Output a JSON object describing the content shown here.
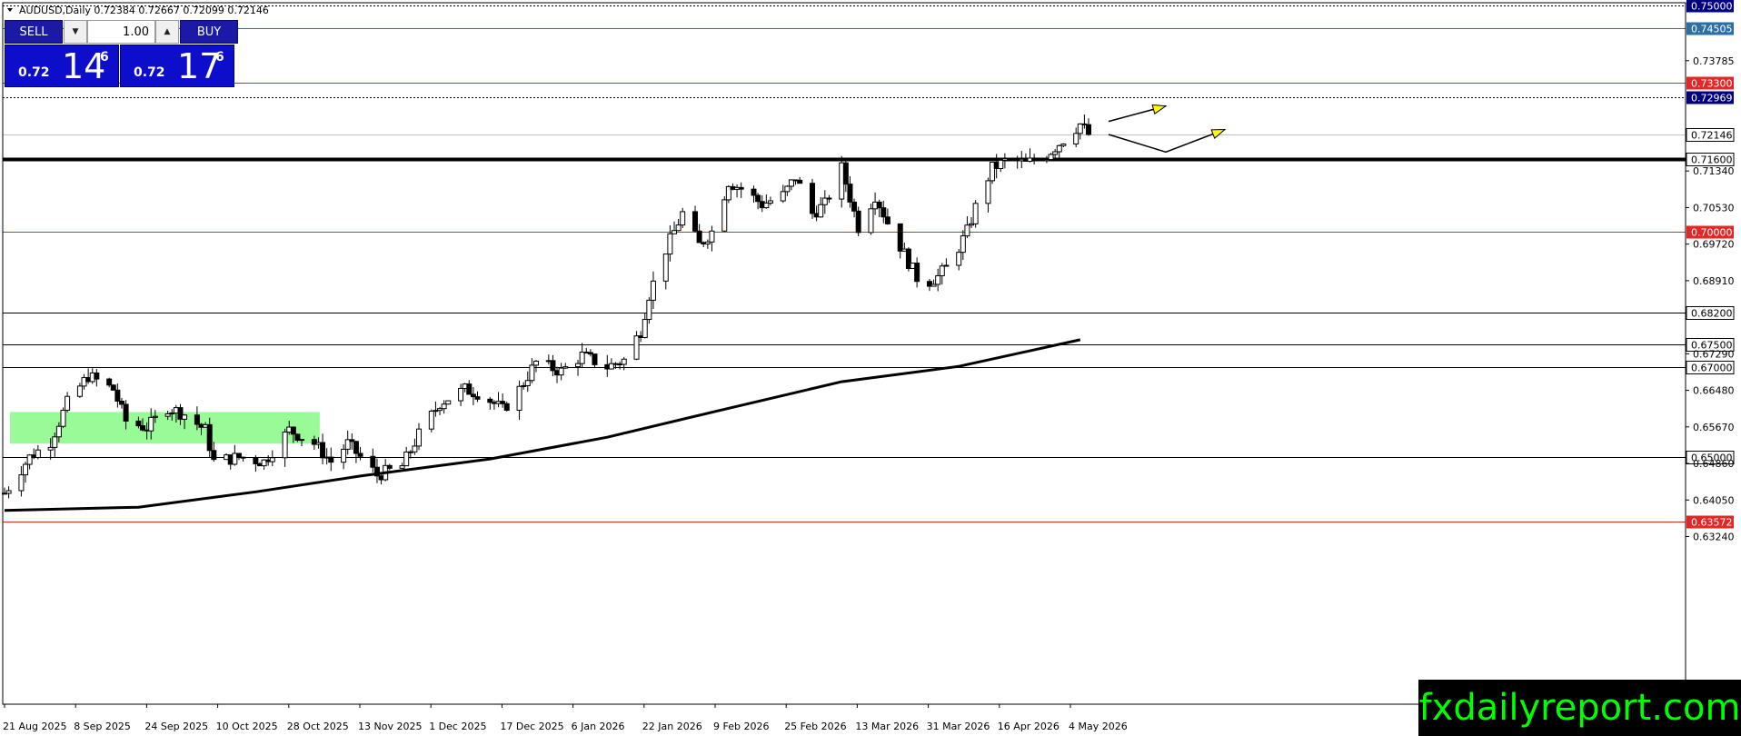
{
  "header": {
    "title": "AUDUSD,Daily  0.72384 0.72667 0.72099 0.72146"
  },
  "trade_panel": {
    "sell_label": "SELL",
    "buy_label": "BUY",
    "lot_size": "1.00",
    "sell_price": {
      "prefix": "0.72",
      "big": "14",
      "sup": "6"
    },
    "buy_price": {
      "prefix": "0.72",
      "big": "17",
      "sup": "6"
    }
  },
  "watermark": "fxdailyreport.com",
  "colors": {
    "green_zone": "#98fb98",
    "red_level": "#e32626",
    "blue_level": "#2e6ea6",
    "arrow_fill": "#ffff00",
    "watermark_text": "#00ff00"
  },
  "chart_data": {
    "type": "candlestick",
    "symbol": "AUDUSD",
    "timeframe": "Daily",
    "ohlc_current": {
      "open": 0.72384,
      "high": 0.72667,
      "low": 0.72099,
      "close": 0.72146
    },
    "ylim": [
      0.6275,
      0.752
    ],
    "y_ticks": [
      "0.73785",
      "0.71340",
      "0.70530",
      "0.69720",
      "0.68910",
      "0.67290",
      "0.66480",
      "0.65670",
      "0.64860",
      "0.64050",
      "0.63240"
    ],
    "x_labels": [
      "21 Aug 2025",
      "8 Sep 2025",
      "24 Sep 2025",
      "10 Oct 2025",
      "28 Oct 2025",
      "13 Nov 2025",
      "1 Dec 2025",
      "17 Dec 2025",
      "6 Jan 2026",
      "22 Jan 2026",
      "9 Feb 2026",
      "25 Feb 2026",
      "13 Mar 2026",
      "31 Mar 2026",
      "16 Apr 2026",
      "4 May 2026"
    ],
    "levels": [
      {
        "price": "0.75000",
        "value": 0.75,
        "style": "dotted",
        "color": "#000000",
        "label_bg": "#000080"
      },
      {
        "price": "0.74505",
        "value": 0.74505,
        "style": "solid",
        "color": "#2e6ea6",
        "label_bg": "#2e6ea6"
      },
      {
        "price": "0.73300",
        "value": 0.733,
        "style": "solid",
        "color": "#e32626",
        "label_bg": "#e32626"
      },
      {
        "price": "0.72969",
        "value": 0.72969,
        "style": "dotted",
        "color": "#000000",
        "label_bg": "#000080"
      },
      {
        "price": "0.72146",
        "value": 0.72146,
        "style": "solid",
        "color": "#c0c0c0",
        "label_bg": "#ffffff"
      },
      {
        "price": "0.71600",
        "value": 0.716,
        "style": "thick",
        "color": "#000000",
        "label_bg": "#ffffff"
      },
      {
        "price": "0.70000",
        "value": 0.7,
        "style": "solid",
        "color": "#e32626",
        "label_bg": "#e32626"
      },
      {
        "price": "0.68200",
        "value": 0.682,
        "style": "solid",
        "color": "#000000",
        "label_bg": "#ffffff"
      },
      {
        "price": "0.67500",
        "value": 0.675,
        "style": "solid",
        "color": "#000000",
        "label_bg": "#ffffff"
      },
      {
        "price": "0.67000",
        "value": 0.67,
        "style": "solid",
        "color": "#000000",
        "label_bg": "#ffffff"
      },
      {
        "price": "0.65000",
        "value": 0.65,
        "style": "solid",
        "color": "#000000",
        "label_bg": "#ffffff"
      },
      {
        "price": "0.63572",
        "value": 0.63572,
        "style": "solid",
        "color": "#e32626",
        "label_bg": "#e32626"
      }
    ],
    "moving_average": [
      {
        "date": "2025-08-21",
        "value": 0.6382
      },
      {
        "date": "2025-09-22",
        "value": 0.6389
      },
      {
        "date": "2025-10-20",
        "value": 0.6423
      },
      {
        "date": "2025-11-14",
        "value": 0.6458
      },
      {
        "date": "2025-12-15",
        "value": 0.6496
      },
      {
        "date": "2026-01-12",
        "value": 0.6544
      },
      {
        "date": "2026-02-09",
        "value": 0.6606
      },
      {
        "date": "2026-03-09",
        "value": 0.6667
      },
      {
        "date": "2026-04-06",
        "value": 0.6701
      },
      {
        "date": "2026-05-05",
        "value": 0.676
      }
    ],
    "zones": [
      {
        "from": "2025-08-21",
        "to": "2025-11-03",
        "low": 0.653,
        "high": 0.66,
        "color": "#98fb98"
      }
    ],
    "price_path": [
      {
        "date": "2025-08-21",
        "value": 0.642
      },
      {
        "date": "2025-08-27",
        "value": 0.65
      },
      {
        "date": "2025-09-01",
        "value": 0.6535
      },
      {
        "date": "2025-09-05",
        "value": 0.662
      },
      {
        "date": "2025-09-10",
        "value": 0.668
      },
      {
        "date": "2025-09-16",
        "value": 0.665
      },
      {
        "date": "2025-09-19",
        "value": 0.658
      },
      {
        "date": "2025-09-24",
        "value": 0.6565
      },
      {
        "date": "2025-09-29",
        "value": 0.661
      },
      {
        "date": "2025-10-03",
        "value": 0.6595
      },
      {
        "date": "2025-10-08",
        "value": 0.656
      },
      {
        "date": "2025-10-10",
        "value": 0.649
      },
      {
        "date": "2025-10-16",
        "value": 0.65
      },
      {
        "date": "2025-10-22",
        "value": 0.649
      },
      {
        "date": "2025-10-28",
        "value": 0.656
      },
      {
        "date": "2025-11-03",
        "value": 0.653
      },
      {
        "date": "2025-11-07",
        "value": 0.649
      },
      {
        "date": "2025-11-11",
        "value": 0.653
      },
      {
        "date": "2025-11-18",
        "value": 0.646
      },
      {
        "date": "2025-11-24",
        "value": 0.648
      },
      {
        "date": "2025-11-28",
        "value": 0.655
      },
      {
        "date": "2025-12-03",
        "value": 0.662
      },
      {
        "date": "2025-12-09",
        "value": 0.665
      },
      {
        "date": "2025-12-13",
        "value": 0.664
      },
      {
        "date": "2025-12-18",
        "value": 0.6605
      },
      {
        "date": "2025-12-22",
        "value": 0.665
      },
      {
        "date": "2025-12-26",
        "value": 0.671
      },
      {
        "date": "2026-01-01",
        "value": 0.669
      },
      {
        "date": "2026-01-06",
        "value": 0.6725
      },
      {
        "date": "2026-01-12",
        "value": 0.67
      },
      {
        "date": "2026-01-16",
        "value": 0.6715
      },
      {
        "date": "2026-01-20",
        "value": 0.678
      },
      {
        "date": "2026-01-22",
        "value": 0.686
      },
      {
        "date": "2026-01-26",
        "value": 0.696
      },
      {
        "date": "2026-01-30",
        "value": 0.704
      },
      {
        "date": "2026-02-03",
        "value": 0.697
      },
      {
        "date": "2026-02-06",
        "value": 0.7
      },
      {
        "date": "2026-02-10",
        "value": 0.711
      },
      {
        "date": "2026-02-14",
        "value": 0.709
      },
      {
        "date": "2026-02-18",
        "value": 0.706
      },
      {
        "date": "2026-02-23",
        "value": 0.708
      },
      {
        "date": "2026-02-26",
        "value": 0.712
      },
      {
        "date": "2026-03-02",
        "value": 0.704
      },
      {
        "date": "2026-03-05",
        "value": 0.706
      },
      {
        "date": "2026-03-09",
        "value": 0.714
      },
      {
        "date": "2026-03-13",
        "value": 0.701
      },
      {
        "date": "2026-03-17",
        "value": 0.708
      },
      {
        "date": "2026-03-20",
        "value": 0.702
      },
      {
        "date": "2026-03-24",
        "value": 0.695
      },
      {
        "date": "2026-03-28",
        "value": 0.688
      },
      {
        "date": "2026-04-01",
        "value": 0.69
      },
      {
        "date": "2026-04-04",
        "value": 0.693
      },
      {
        "date": "2026-04-08",
        "value": 0.7
      },
      {
        "date": "2026-04-11",
        "value": 0.708
      },
      {
        "date": "2026-04-14",
        "value": 0.714
      },
      {
        "date": "2026-04-18",
        "value": 0.716
      },
      {
        "date": "2026-04-22",
        "value": 0.715
      },
      {
        "date": "2026-04-27",
        "value": 0.717
      },
      {
        "date": "2026-04-30",
        "value": 0.7195
      },
      {
        "date": "2026-05-05",
        "value": 0.7238
      },
      {
        "date": "2026-05-07",
        "value": 0.7215
      }
    ],
    "annotations": [
      "up arrow from 0.7225",
      "down-then-up arrow from 0.7215 to 0.7176 to 0.7220"
    ]
  }
}
